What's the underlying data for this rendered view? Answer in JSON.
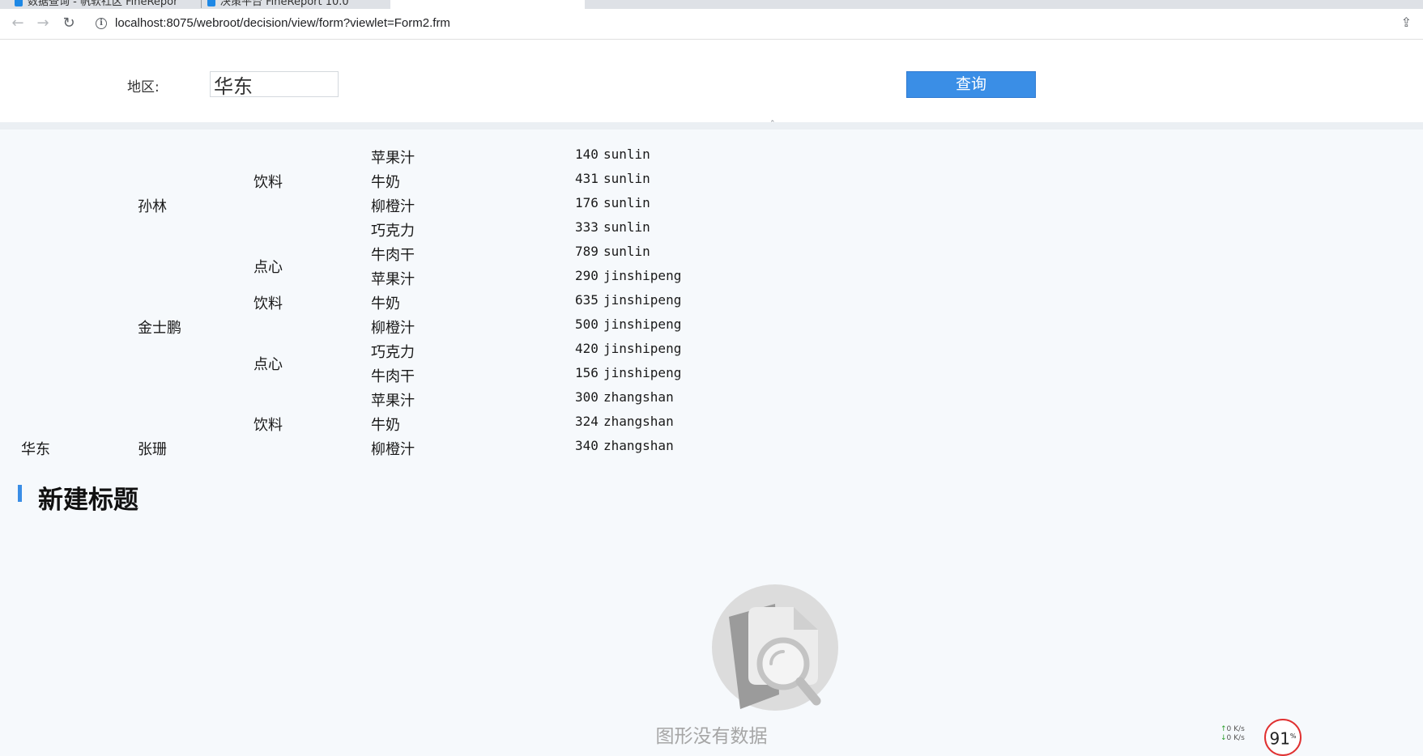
{
  "browser": {
    "tabs": [
      {
        "title": "数据查询 - 帆软社区 FineReport ..."
      },
      {
        "title": "决策平台 FineReport 10.0"
      },
      {
        "title": ""
      },
      {
        "title": ""
      }
    ],
    "url": "localhost:8075/webroot/decision/view/form?viewlet=Form2.frm"
  },
  "params": {
    "region_label": "地区:",
    "region_value": "华东",
    "query_button": "查询"
  },
  "report": {
    "rows": [
      {
        "region": "",
        "salesperson": "",
        "category": "",
        "product": "苹果汁",
        "sales": "140",
        "name": "sunlin"
      },
      {
        "region": "",
        "salesperson": "",
        "category": "饮料",
        "product": "牛奶",
        "sales": "431",
        "name": "sunlin"
      },
      {
        "region": "",
        "salesperson": "孙林",
        "category": "",
        "product": "柳橙汁",
        "sales": "176",
        "name": "sunlin"
      },
      {
        "region": "",
        "salesperson": "",
        "category": "",
        "product": "巧克力",
        "sales": "333",
        "name": "sunlin"
      },
      {
        "region": "",
        "salesperson": "",
        "category": "点心",
        "product": "牛肉干",
        "sales": "789",
        "name": "sunlin"
      },
      {
        "region": "",
        "salesperson": "",
        "category": "",
        "product": "苹果汁",
        "sales": "290",
        "name": "jinshipeng"
      },
      {
        "region": "",
        "salesperson": "",
        "category": "饮料",
        "product": "牛奶",
        "sales": "635",
        "name": "jinshipeng"
      },
      {
        "region": "",
        "salesperson": "金士鹏",
        "category": "",
        "product": "柳橙汁",
        "sales": "500",
        "name": "jinshipeng"
      },
      {
        "region": "",
        "salesperson": "",
        "category": "点心",
        "product": "巧克力",
        "sales": "420",
        "name": "jinshipeng"
      },
      {
        "region": "",
        "salesperson": "",
        "category": "",
        "product": "牛肉干",
        "sales": "156",
        "name": "jinshipeng"
      },
      {
        "region": "",
        "salesperson": "",
        "category": "",
        "product": "苹果汁",
        "sales": "300",
        "name": "zhangshan"
      },
      {
        "region": "",
        "salesperson": "",
        "category": "饮料",
        "product": "牛奶",
        "sales": "324",
        "name": "zhangshan"
      },
      {
        "region": "华东",
        "salesperson": "张珊",
        "category": "",
        "product": "柳橙汁",
        "sales": "340",
        "name": "zhangshan"
      }
    ]
  },
  "chart_widget": {
    "title": "新建标题",
    "empty_message": "图形没有数据",
    "empty_icon": "document-search-icon"
  },
  "tray": {
    "upload_speed": "0 K/s",
    "download_speed": "0 K/s",
    "cpu_percent": "91",
    "cpu_unit": "%"
  },
  "colors": {
    "accent": "#3a8ee6",
    "page_background": "#f6f9fc",
    "gauge_ring": "#e03131"
  }
}
